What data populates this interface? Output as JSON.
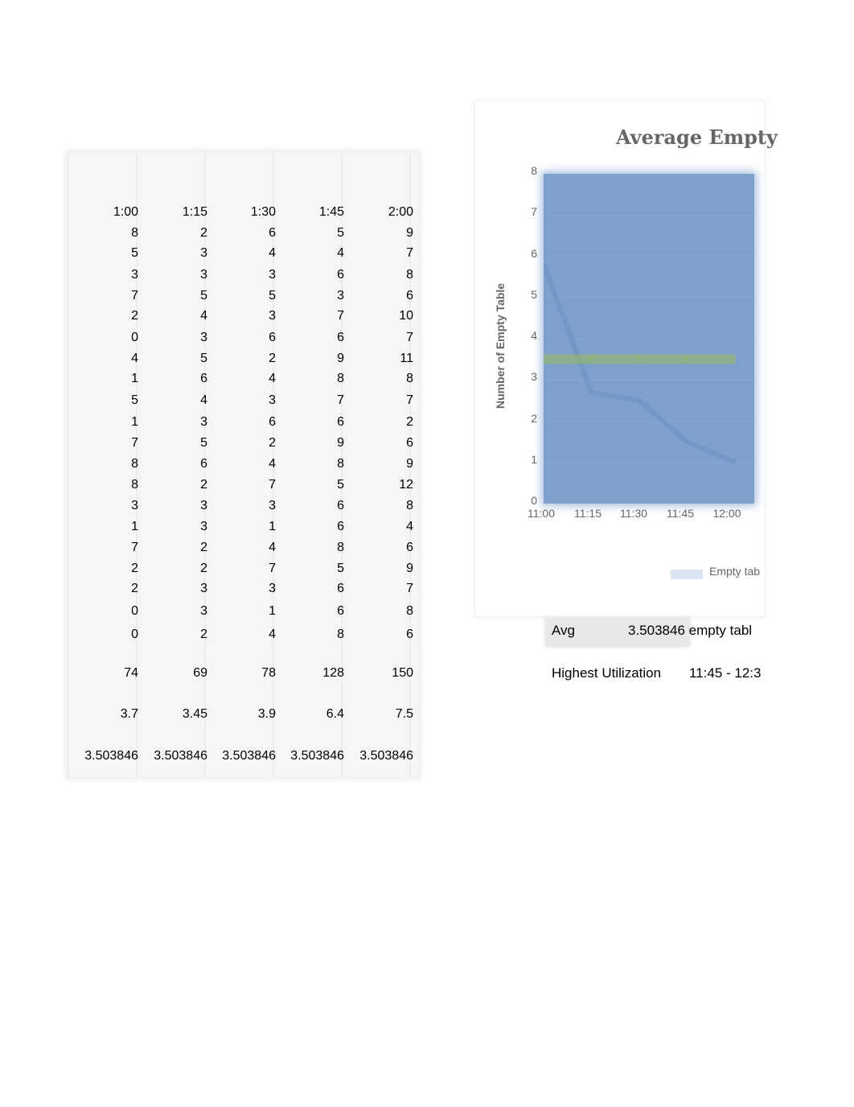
{
  "table": {
    "headers": [
      "1:00",
      "1:15",
      "1:30",
      "1:45",
      "2:00"
    ],
    "rows": [
      [
        8,
        2,
        6,
        5,
        9
      ],
      [
        5,
        3,
        4,
        4,
        7
      ],
      [
        3,
        3,
        3,
        6,
        8
      ],
      [
        7,
        5,
        5,
        3,
        6
      ],
      [
        2,
        4,
        3,
        7,
        10
      ],
      [
        0,
        3,
        6,
        6,
        7
      ],
      [
        4,
        5,
        2,
        9,
        11
      ],
      [
        1,
        6,
        4,
        8,
        8
      ],
      [
        5,
        4,
        3,
        7,
        7
      ],
      [
        1,
        3,
        6,
        6,
        2
      ],
      [
        7,
        5,
        2,
        9,
        6
      ],
      [
        8,
        6,
        4,
        8,
        9
      ],
      [
        8,
        2,
        7,
        5,
        12
      ],
      [
        3,
        3,
        3,
        6,
        8
      ],
      [
        1,
        3,
        1,
        6,
        4
      ],
      [
        7,
        2,
        4,
        8,
        6
      ],
      [
        2,
        2,
        7,
        5,
        9
      ],
      [
        2,
        3,
        3,
        6,
        7
      ],
      [
        0,
        3,
        1,
        6,
        8
      ],
      [
        0,
        2,
        4,
        8,
        6
      ]
    ],
    "totals": [
      74,
      69,
      78,
      128,
      150
    ],
    "averages": [
      3.7,
      3.45,
      3.9,
      6.4,
      7.5
    ],
    "overall_avg": [
      "3.503846",
      "3.503846",
      "3.503846",
      "3.503846",
      "3.503846"
    ]
  },
  "summary": {
    "avg_label": "Avg",
    "avg_value": "3.503846 empty tabl",
    "highest_label": "Highest Utilization",
    "highest_value": "11:45 - 12:3"
  },
  "chart_data": {
    "type": "line",
    "title": "Average Empty",
    "xlabel": "",
    "ylabel": "Number of Empty Table",
    "categories": [
      "11:00",
      "11:15",
      "11:30",
      "11:45",
      "12:00"
    ],
    "ylim": [
      0,
      8
    ],
    "yticks": [
      0,
      1,
      2,
      3,
      4,
      5,
      6,
      7,
      8
    ],
    "series": [
      {
        "name": "Empty tab",
        "values": [
          5.8,
          2.7,
          2.5,
          1.5,
          1.0
        ],
        "color": "#6f93c4"
      },
      {
        "name": "Avg",
        "values": [
          3.503846,
          3.503846,
          3.503846,
          3.503846,
          3.503846
        ],
        "color": "#9bbb59"
      }
    ],
    "legend": "bottom-right",
    "legend_label": "Empty tab",
    "grid": true
  },
  "colors": {
    "plot_bg": "#7ea0cc",
    "avg_line": "#9bbb59",
    "text_muted": "#666666"
  }
}
